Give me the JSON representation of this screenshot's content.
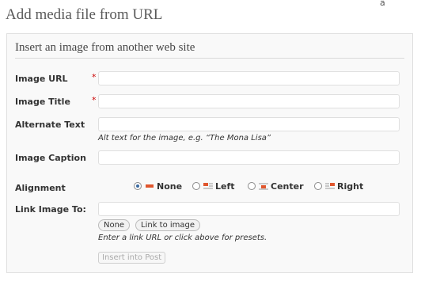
{
  "page": {
    "title": "Add media file from URL",
    "corner_mark": "ä"
  },
  "panel": {
    "title": "Insert an image from another web site"
  },
  "fields": {
    "url": {
      "label": "Image URL",
      "required_mark": "*",
      "value": ""
    },
    "title": {
      "label": "Image Title",
      "required_mark": "*",
      "value": ""
    },
    "alt": {
      "label": "Alternate Text",
      "value": "",
      "help": "Alt text for the image, e.g. “The Mona Lisa”"
    },
    "caption": {
      "label": "Image Caption",
      "value": ""
    },
    "link": {
      "label": "Link Image To:",
      "value": "",
      "help": "Enter a link URL or click above for presets."
    }
  },
  "alignment": {
    "label": "Alignment",
    "options": [
      {
        "label": "None",
        "icon": "align-none-icon",
        "selected": true
      },
      {
        "label": "Left",
        "icon": "align-left-icon",
        "selected": false
      },
      {
        "label": "Center",
        "icon": "align-center-icon",
        "selected": false
      },
      {
        "label": "Right",
        "icon": "align-right-icon",
        "selected": false
      }
    ]
  },
  "link_buttons": {
    "none": "None",
    "link_to_image": "Link to image"
  },
  "submit": {
    "label": "Insert into Post",
    "disabled": true
  },
  "colors": {
    "required": "#cc0000",
    "align_accent": "#e0562e",
    "radio_selected": "#3b6aa0"
  }
}
